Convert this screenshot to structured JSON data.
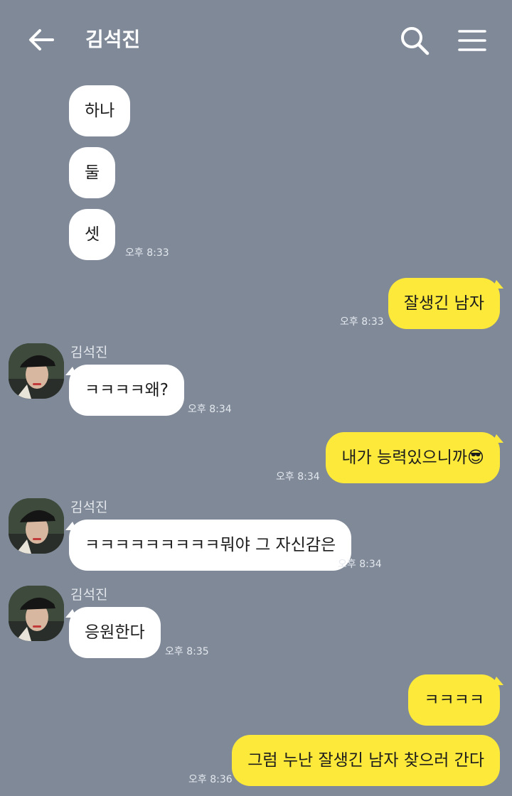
{
  "header": {
    "title": "김석진",
    "icons": [
      "back-arrow-icon",
      "search-icon",
      "menu-icon"
    ]
  },
  "colors": {
    "background": "#7f8998",
    "incoming_bubble": "#ffffff",
    "outgoing_bubble": "#fde93a"
  },
  "messages": [
    {
      "direction": "incoming",
      "text": "하나"
    },
    {
      "direction": "incoming",
      "text": "둘"
    },
    {
      "direction": "incoming",
      "text": "셋",
      "time": "오후 8:33"
    },
    {
      "direction": "outgoing",
      "text": "잘생긴 남자",
      "time": "오후 8:33"
    },
    {
      "direction": "incoming",
      "sender": "김석진",
      "text": "ㅋㅋㅋㅋ왜?",
      "time": "오후 8:34"
    },
    {
      "direction": "outgoing",
      "text": "내가 능력있으니까😎",
      "time": "오후 8:34"
    },
    {
      "direction": "incoming",
      "sender": "김석진",
      "text": "ㅋㅋㅋㅋㅋㅋㅋㅋㅋ뭐야 그 자신감은",
      "time": "오후 8:34"
    },
    {
      "direction": "incoming",
      "sender": "김석진",
      "text": "응원한다",
      "time": "오후 8:35"
    },
    {
      "direction": "outgoing",
      "text": "ㅋㅋㅋㅋ"
    },
    {
      "direction": "outgoing",
      "text": "그럼 누난 잘생긴 남자 찾으러 간다",
      "time": "오후 8:36"
    }
  ]
}
